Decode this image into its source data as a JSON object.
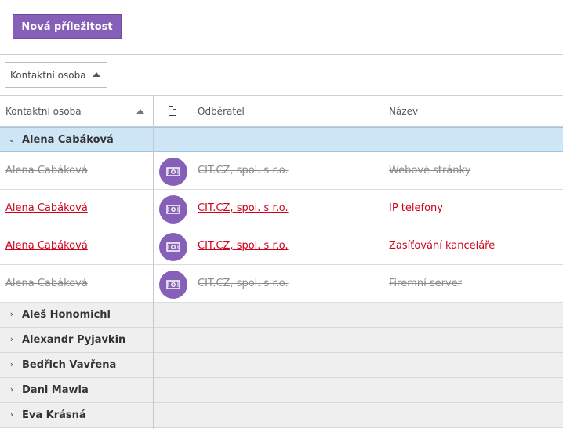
{
  "toolbar": {
    "new_button_label": "Nová příležitost"
  },
  "grouping": {
    "chip_label": "Kontaktní osoba"
  },
  "columns": {
    "contact": "Kontaktní osoba",
    "customer": "Odběratel",
    "name": "Název"
  },
  "groups": [
    {
      "label": "Alena Cabáková",
      "expanded": true,
      "rows": [
        {
          "contact": "Alena Cabáková",
          "customer": "CIT.CZ, spol. s r.o.",
          "name": "Webové stránky",
          "state": "inactive"
        },
        {
          "contact": "Alena Cabáková",
          "customer": "CIT.CZ, spol. s r.o.",
          "name": "IP telefony",
          "state": "active"
        },
        {
          "contact": "Alena Cabáková",
          "customer": "CIT.CZ, spol. s r.o.",
          "name": "Zasíťování kanceláře",
          "state": "active"
        },
        {
          "contact": "Alena Cabáková",
          "customer": "CIT.CZ, spol. s r.o.",
          "name": "Firemní server",
          "state": "inactive"
        }
      ]
    },
    {
      "label": "Aleš Honomichl",
      "expanded": false
    },
    {
      "label": "Alexandr Pyjavkin",
      "expanded": false
    },
    {
      "label": "Bedřich Vavřena",
      "expanded": false
    },
    {
      "label": "Dani Mawla",
      "expanded": false
    },
    {
      "label": "Eva Krásná",
      "expanded": false
    }
  ],
  "icons": {
    "row_badge": "opportunity-money-icon",
    "doc_column": "document-icon"
  },
  "colors": {
    "accent": "#8660b8",
    "active_text": "#d0021b",
    "inactive_text": "#8a8a8a",
    "group_selected_bg": "#cfe6f7",
    "group_bg": "#efefef"
  }
}
